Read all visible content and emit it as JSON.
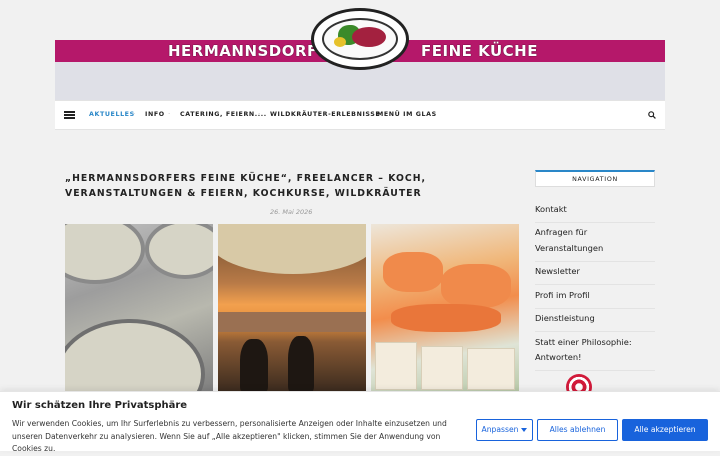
{
  "header": {
    "title_left": "HERMANNSDORFERS",
    "title_right": "FEINE KÜCHE",
    "brand_color": "#b5186a"
  },
  "nav": {
    "menu_icon": "hamburger-icon",
    "items": [
      {
        "label": "AKTUELLES",
        "active": true
      },
      {
        "label": "INFO"
      },
      {
        "label": "CATERING, FEIERN...."
      },
      {
        "label": "WILDKRÄUTER-ERLEBNISSE"
      },
      {
        "label": "MENÜ IM GLAS"
      }
    ],
    "search_icon": "search-icon",
    "accent_color": "#2a87c8"
  },
  "post": {
    "title": "„HERMANNSDORFERS FEINE KÜCHE“, FREELANCER – KOCH, VERANSTALTUNGEN & FEIERN, KOCHKURSE, WILDKRÄUTER",
    "date": "26. Mai 2026"
  },
  "sidebar": {
    "heading": "NAVIGATION",
    "items": [
      {
        "label": "Kontakt"
      },
      {
        "label": "Anfragen für Veranstaltungen"
      },
      {
        "label": "Newsletter"
      },
      {
        "label": "Profi im Profil"
      },
      {
        "label": "Dienstleistung"
      },
      {
        "label": "Statt einer Philosophie: Antworten!"
      }
    ]
  },
  "cookie": {
    "title": "Wir schätzen Ihre Privatsphäre",
    "text": "Wir verwenden Cookies, um Ihr Surferlebnis zu verbessern, personalisierte Anzeigen oder Inhalte einzusetzen und unseren Datenverkehr zu analysieren. Wenn Sie auf „Alle akzeptieren\" klicken, stimmen Sie der Anwendung von Cookies zu.",
    "customize_label": "Anpassen",
    "reject_label": "Alles ablehnen",
    "accept_label": "Alle akzeptieren",
    "button_color": "#1863dc"
  }
}
